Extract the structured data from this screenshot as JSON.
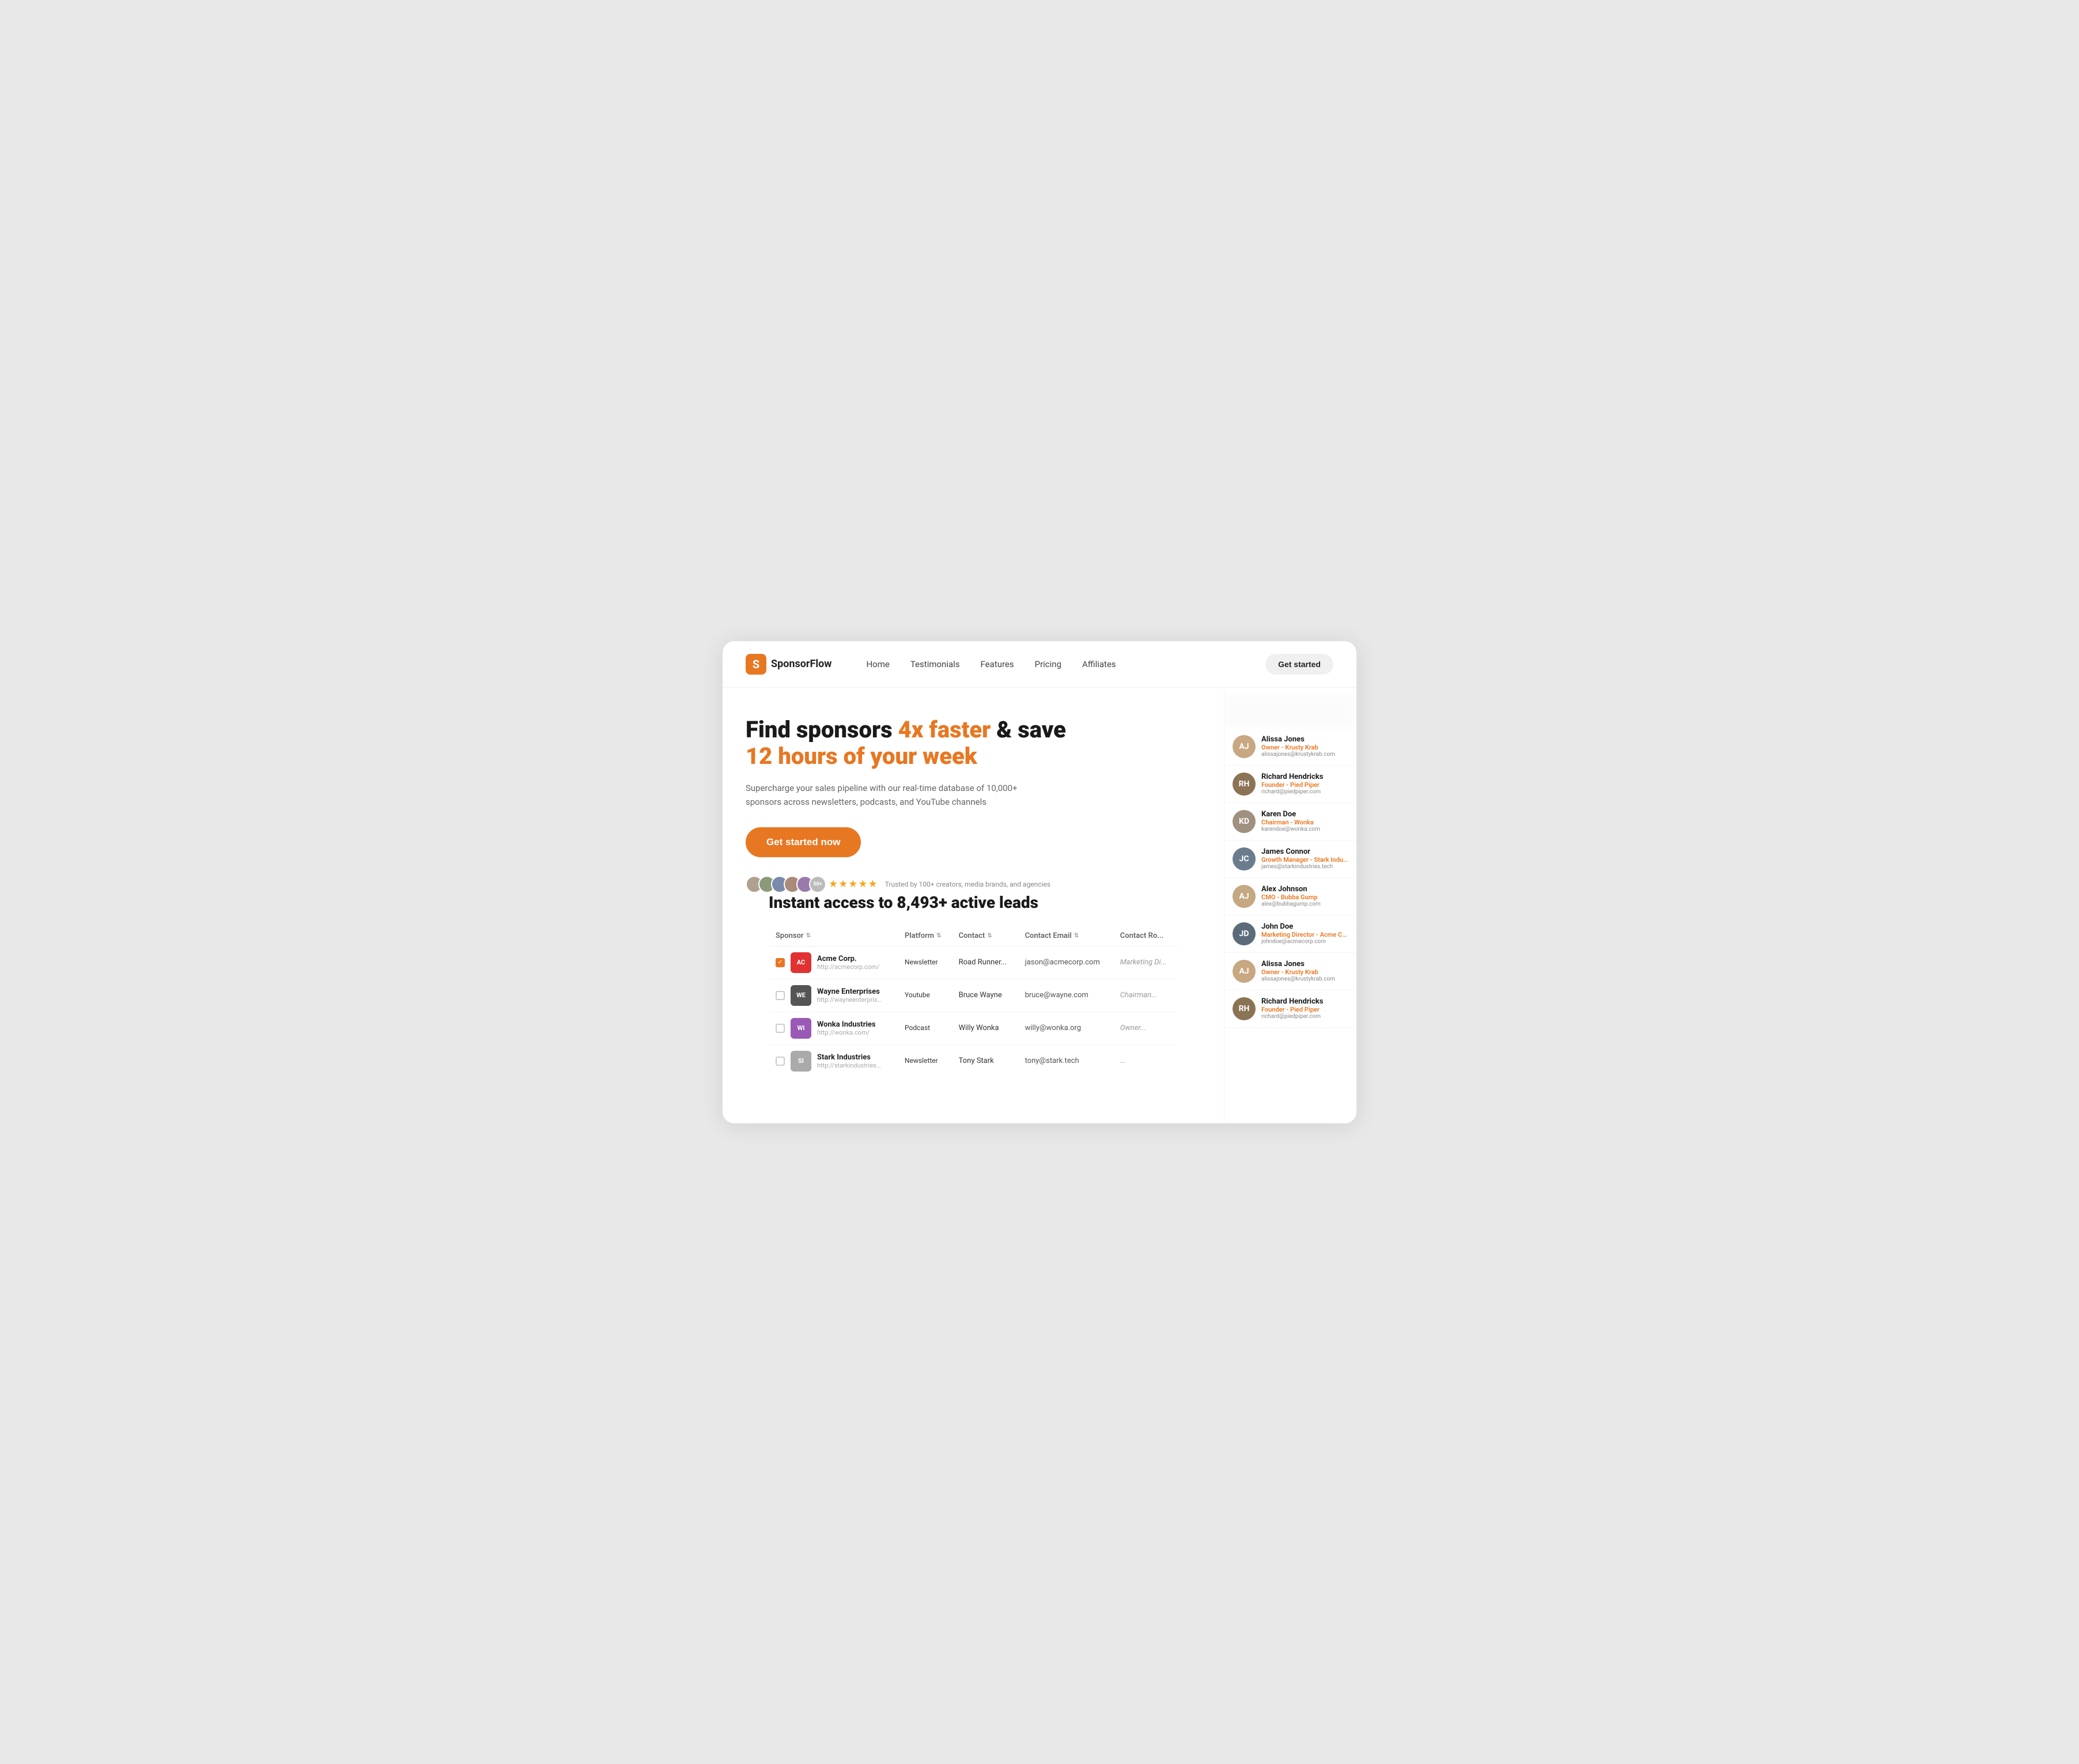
{
  "brand": {
    "logo_letter": "S",
    "name": "SponsorFlow"
  },
  "nav": {
    "links": [
      {
        "label": "Home",
        "key": "home"
      },
      {
        "label": "Testimonials",
        "key": "testimonials"
      },
      {
        "label": "Features",
        "key": "features"
      },
      {
        "label": "Pricing",
        "key": "pricing"
      },
      {
        "label": "Affiliates",
        "key": "affiliates"
      }
    ],
    "cta_label": "Get started"
  },
  "hero": {
    "title_prefix": "Find sponsors ",
    "title_highlight1": "4x faster",
    "title_middle": " & save ",
    "title_highlight2": "12 hours of your week",
    "subtitle": "Supercharge your sales pipeline with our real-time database of 10,000+ sponsors across newsletters, podcasts, and YouTube channels",
    "cta_label": "Get started now",
    "trusted_text": "Trusted by 100+ creators, media brands, and agencies",
    "avatar_count": "50+",
    "stars": "★★★★★"
  },
  "leads_section": {
    "title": "Instant access to 8,493+ active leads",
    "table": {
      "headers": [
        "Sponsor",
        "Platform",
        "Contact",
        "Contact Email",
        "Contact Ro..."
      ],
      "rows": [
        {
          "checked": true,
          "logo_color": "#e03232",
          "logo_text": "AC",
          "name": "Acme Corp.",
          "url": "http://acmecorp.com/",
          "platform": "Newsletter",
          "contact": "Road Runner...",
          "email": "jason@acmecorp.com",
          "role": "Marketing Di..."
        },
        {
          "checked": false,
          "logo_color": "#555",
          "logo_text": "WE",
          "name": "Wayne Enterprises",
          "url": "http://wayneenterpris...",
          "platform": "Youtube",
          "contact": "Bruce Wayne",
          "email": "bruce@wayne.com",
          "role": "Chairman..."
        },
        {
          "checked": false,
          "logo_color": "#9b59b6",
          "logo_text": "WI",
          "name": "Wonka Industries",
          "url": "http://wonka.com/",
          "platform": "Podcast",
          "contact": "Willy Wonka",
          "email": "willy@wonka.org",
          "role": "Owner..."
        },
        {
          "checked": false,
          "logo_color": "#aaa",
          "logo_text": "SI",
          "name": "Stark Industries",
          "url": "http://starkindustries...",
          "platform": "Newsletter",
          "contact": "Tony Stark",
          "email": "tony@stark.tech",
          "role": "..."
        }
      ]
    }
  },
  "right_panel": {
    "contacts": [
      {
        "name": "Alissa Jones",
        "role": "Owner - Krusty Krab",
        "email": "alissajones@krustykrab.com",
        "avatar_color": "#c8a882",
        "avatar_letter": "AJ"
      },
      {
        "name": "Richard Hendricks",
        "role": "Founder - Pied Piper",
        "email": "richard@piedpiper.com",
        "avatar_color": "#8b7355",
        "avatar_letter": "RH"
      },
      {
        "name": "Karen Doe",
        "role": "Chairman - Wonka",
        "email": "karendoe@wonka.com",
        "avatar_color": "#a09080",
        "avatar_letter": "KD"
      },
      {
        "name": "James Connor",
        "role": "Growth Manager - Stark Industrie...",
        "email": "james@starkindustries.tech",
        "avatar_color": "#6b7c8d",
        "avatar_letter": "JC"
      },
      {
        "name": "Alex Johnson",
        "role": "CMO - Bubba Gump",
        "email": "alex@bubbagump.com",
        "avatar_color": "#c4a882",
        "avatar_letter": "AJ"
      },
      {
        "name": "John Doe",
        "role": "Marketing Director - Acme Corp",
        "email": "johndoe@acmecorp.com",
        "avatar_color": "#5c6b7a",
        "avatar_letter": "JD"
      },
      {
        "name": "Alissa Jones",
        "role": "Owner - Krusty Krab",
        "email": "alissajones@krustykrab.com",
        "avatar_color": "#c8a882",
        "avatar_letter": "AJ"
      },
      {
        "name": "Richard Hendricks",
        "role": "Founder - Pied Piper",
        "email": "richard@piedpiper.com",
        "avatar_color": "#8b7355",
        "avatar_letter": "RH"
      }
    ]
  }
}
